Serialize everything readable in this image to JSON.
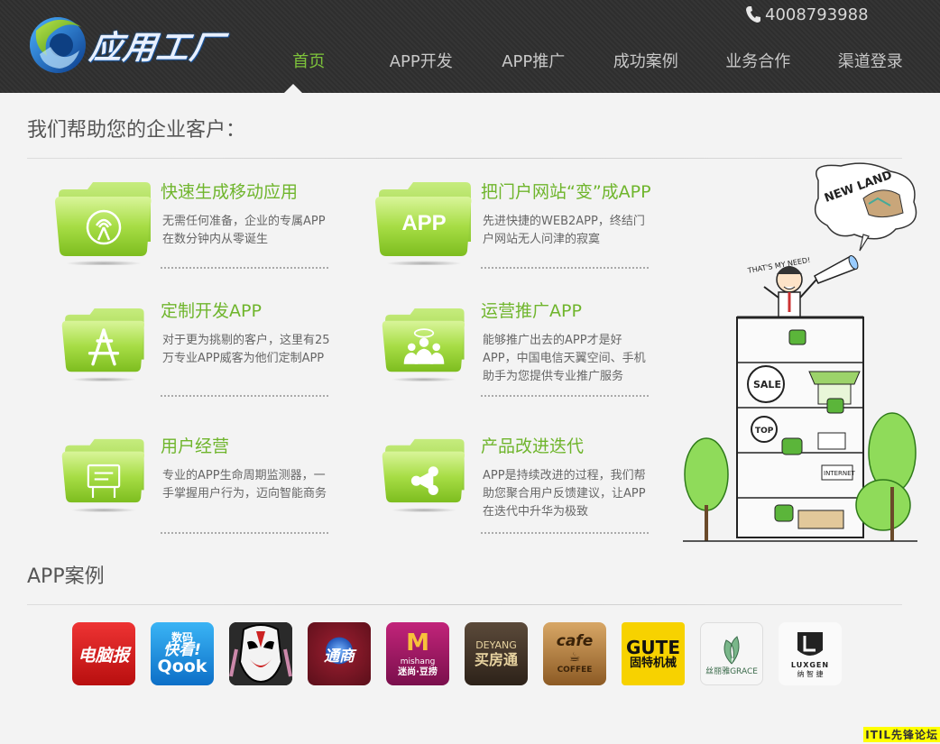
{
  "header": {
    "logo_text": "应用工厂",
    "phone": "4008793988",
    "nav": [
      "首页",
      "APP开发",
      "APP推广",
      "成功案例",
      "业务合作",
      "渠道登录"
    ]
  },
  "main": {
    "heading": "我们帮助您的企业客户：",
    "features": [
      {
        "title": "快速生成移动应用",
        "desc": "无需任何准备，企业的专属APP在数分钟内从零诞生",
        "icon": "signal-icon"
      },
      {
        "title": "把门户网站“变”成APP",
        "desc": "先进快捷的WEB2APP，终结门户网站无人问津的寂寞",
        "icon_text": "APP",
        "icon": "app-text-icon"
      },
      {
        "title": "定制开发APP",
        "desc": "对于更为挑剔的客户，这里有25万专业APP威客为他们定制APP",
        "icon": "app-store-icon"
      },
      {
        "title": "运营推广APP",
        "desc": "能够推广出去的APP才是好APP，中国电信天翼空间、手机助手为您提供专业推广服务",
        "icon": "users-icon"
      },
      {
        "title": "用户经营",
        "desc": "专业的APP生命周期监测器，一手掌握用户行为，迈向智能商务",
        "icon": "billboard-icon"
      },
      {
        "title": "产品改进迭代",
        "desc": "APP是持续改进的过程，我们帮助您聚合用户反馈建议，让APP在迭代中升华为极致",
        "icon": "share-icon"
      }
    ],
    "cartoon": {
      "bubble_text": "NEW LAND",
      "speech": "THAT'S MY NEED!"
    },
    "cases_heading": "APP案例",
    "apps": [
      {
        "name": "电脑报"
      },
      {
        "name": "数码快看 Qook",
        "line1": "数码",
        "line2": "快看!",
        "line3": "Qook"
      },
      {
        "name": "京剧脸谱"
      },
      {
        "name": "通商",
        "label": "通商"
      },
      {
        "name": "迷尚·豆捞",
        "line1": "mishang",
        "line2": "迷尚·豆捞"
      },
      {
        "name": "德阳买房通",
        "line1": "DEYANG",
        "line2": "买房通"
      },
      {
        "name": "cafe COFFEE",
        "line1": "cafe",
        "line2": "COFFEE"
      },
      {
        "name": "GUTE 固特机械",
        "line1": "GUTE",
        "line2": "固特机械"
      },
      {
        "name": "丝丽雅 GRACE",
        "line1": "丝丽雅GRACE"
      },
      {
        "name": "纳智捷 LUXGEN",
        "line1": "LUXGEN",
        "line2": "纳 智 捷"
      }
    ]
  },
  "watermark": "ITIL先锋论坛",
  "colors": {
    "accent": "#7ec43b",
    "header_bg": "#2e2e2e"
  }
}
